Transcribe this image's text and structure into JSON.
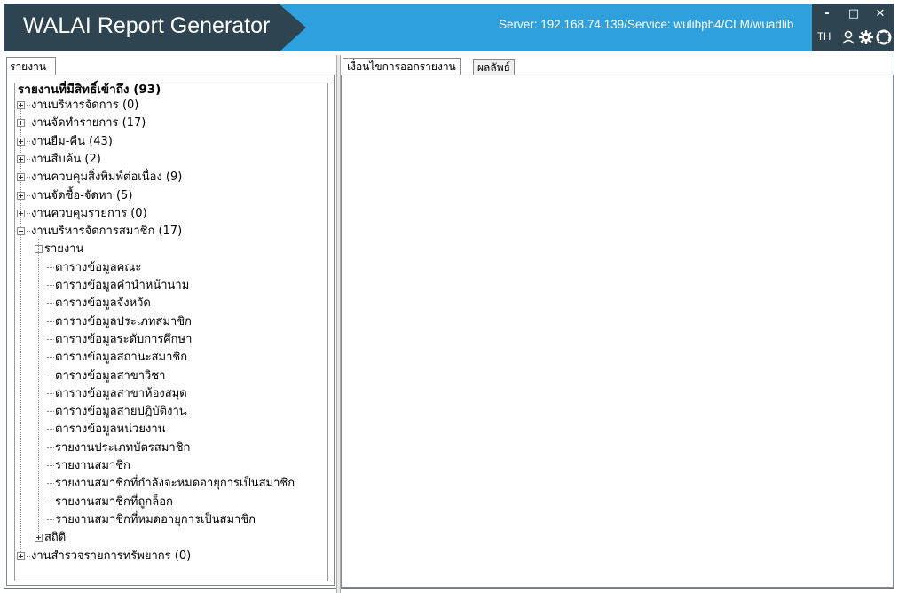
{
  "app": {
    "title": "WALAI Report Generator",
    "server": "Server: 192.168.74.139/Service: wulibph4/CLM/wuadlib",
    "language": "TH"
  },
  "window_controls": {
    "minimize": "-",
    "maximize": "□",
    "close": "✕"
  },
  "left_panel": {
    "tab_label": "รายงาน",
    "tree": {
      "root_label": "รายงานที่มีสิทธิ์เข้าถึง (93)",
      "groups": [
        "งานบริหารจัดการ (0)",
        "งานจัดทำรายการ (17)",
        "งานยืม-คืน (43)",
        "งานสืบค้น (2)",
        "งานควบคุมสิ่งพิมพ์ต่อเนื่อง (9)",
        "งานจัดซื้อ-จัดหา (5)",
        "งานควบคุมรายการ (0)",
        "งานบริหารจัดการสมาชิก (17)"
      ],
      "expanded_sub": "รายงาน",
      "sub_items": [
        "ตารางข้อมูลคณะ",
        "ตารางข้อมูลคำนำหน้านาม",
        "ตารางข้อมูลจังหวัด",
        "ตารางข้อมูลประเภทสมาชิก",
        "ตารางข้อมูลระดับการศึกษา",
        "ตารางข้อมูลสถานะสมาชิก",
        "ตารางข้อมูลสาขาวิชา",
        "ตารางข้อมูลสาขาห้องสมุด",
        "ตารางข้อมูลสายปฏิบัติงาน",
        "ตารางข้อมูลหน่วยงาน",
        "รายงานประเภทบัตรสมาชิก",
        "รายงานสมาชิก",
        "รายงานสมาชิกที่กำลังจะหมดอายุการเป็นสมาชิก",
        "รายงานสมาชิกที่ถูกล็อก",
        "รายงานสมาชิกที่หมดอายุการเป็นสมาชิก"
      ],
      "stats_label": "สถิติ",
      "last_group": "งานสำรวจรายการทรัพยากร (0)"
    }
  },
  "right_panel": {
    "tabs": [
      "เงื่อนไขการออกรายงาน",
      "ผลลัพธ์"
    ]
  },
  "colors": {
    "titlebar_dark": "#2f4451",
    "titlebar_accent": "#2ea0dd"
  }
}
